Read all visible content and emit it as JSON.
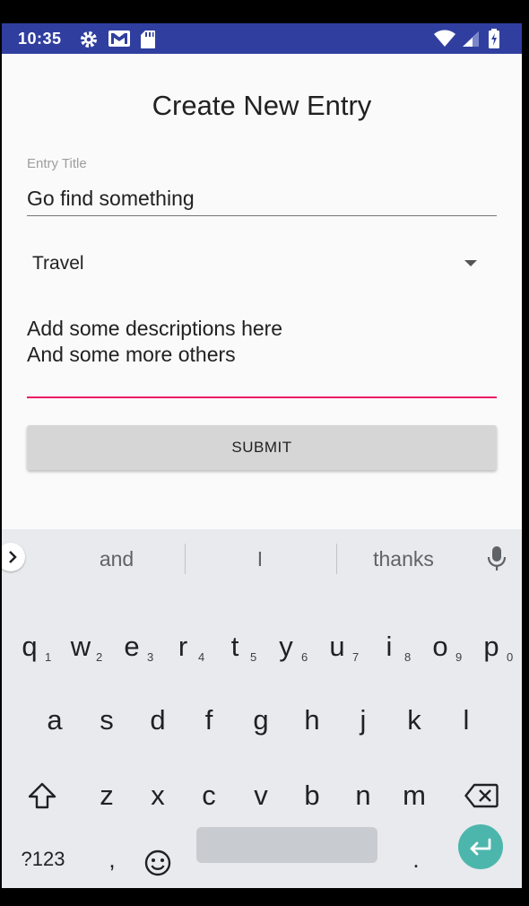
{
  "status_bar": {
    "time": "10:35",
    "left_icons": [
      "gear-icon",
      "gmail-icon",
      "sd-card-icon"
    ],
    "right_icons": [
      "wifi-icon",
      "signal-icon",
      "battery-charging-icon"
    ]
  },
  "form": {
    "page_title": "Create New Entry",
    "title_label": "Entry Title",
    "title_value": "Go find something",
    "category_value": "Travel",
    "description_lines": [
      "Add some descriptions here",
      "And some more others"
    ],
    "submit_label": "SUBMIT",
    "colors": {
      "accent": "#e91e63",
      "status_bar": "#303f9f"
    }
  },
  "keyboard": {
    "suggestions": [
      "and",
      "I",
      "thanks"
    ],
    "row1": [
      {
        "key": "q",
        "hint": "1"
      },
      {
        "key": "w",
        "hint": "2"
      },
      {
        "key": "e",
        "hint": "3"
      },
      {
        "key": "r",
        "hint": "4"
      },
      {
        "key": "t",
        "hint": "5"
      },
      {
        "key": "y",
        "hint": "6"
      },
      {
        "key": "u",
        "hint": "7"
      },
      {
        "key": "i",
        "hint": "8"
      },
      {
        "key": "o",
        "hint": "9"
      },
      {
        "key": "p",
        "hint": "0"
      }
    ],
    "row2": [
      "a",
      "s",
      "d",
      "f",
      "g",
      "h",
      "j",
      "k",
      "l"
    ],
    "row3": [
      "z",
      "x",
      "c",
      "v",
      "b",
      "n",
      "m"
    ],
    "symbols_label": "?123",
    "comma": ",",
    "period": ".",
    "accent_color": "#4db6ac"
  }
}
